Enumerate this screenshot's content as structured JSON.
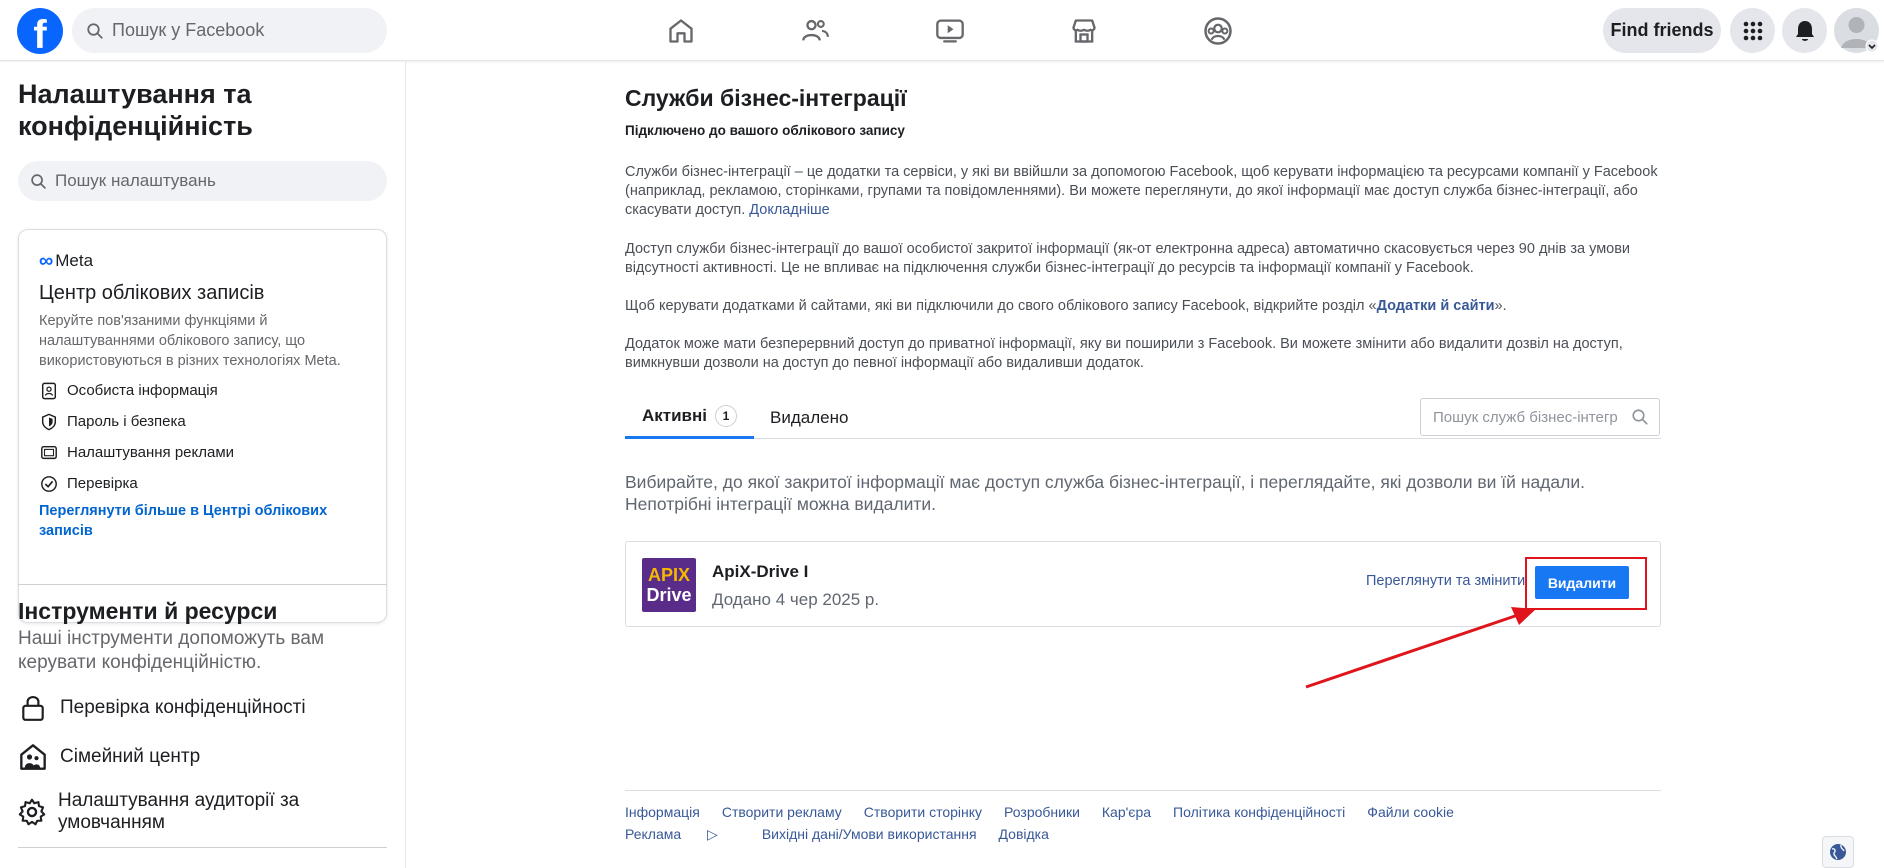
{
  "topbar": {
    "logo_letter": "f",
    "search_placeholder": "Пошук у Facebook",
    "nav_icons": [
      "home-icon",
      "friends-icon",
      "watch-icon",
      "marketplace-icon",
      "groups-icon"
    ],
    "find_friends_label": "Find friends",
    "right_icons": [
      "menu-grid-icon",
      "notifications-bell-icon",
      "account-avatar-icon"
    ]
  },
  "sidebar": {
    "title": "Налаштування та конфіденційність",
    "search_placeholder": "Пошук налаштувань",
    "meta_card": {
      "brand": "Meta",
      "title": "Центр облікових записів",
      "description": "Керуйте пов'язаними функціями й налаштуваннями облікового запису, що використовуються в різних технологіях Meta.",
      "items": [
        {
          "label": "Особиста інформація",
          "icon": "id-card-icon"
        },
        {
          "label": "Пароль і безпека",
          "icon": "shield-icon"
        },
        {
          "label": "Налаштування реклами",
          "icon": "monitor-icon"
        },
        {
          "label": "Перевірка",
          "icon": "verified-badge-icon"
        }
      ],
      "link": "Переглянути більше в Центрі облікових записів"
    },
    "tools": {
      "title": "Інструменти й ресурси",
      "description": "Наші інструменти допоможуть вам керувати конфіденційністю.",
      "items": [
        {
          "label": "Перевірка конфіденційності",
          "icon": "lock-icon"
        },
        {
          "label": "Сімейний центр",
          "icon": "family-home-icon"
        },
        {
          "label": "Налаштування аудиторії за умовчанням",
          "icon": "gear-icon"
        }
      ]
    }
  },
  "main": {
    "title": "Служби бізнес-інтеграції",
    "subtitle": "Підключено до вашого облікового запису",
    "para1_text": "Служби бізнес-інтеграції – це додатки та сервіси, у які ви ввійшли за допомогою Facebook, щоб керувати інформацією та ресурсами компанії у Facebook (наприклад, рекламою, сторінками, групами та повідомленнями). Ви можете переглянути, до якої інформації має доступ служба бізнес-інтеграції, або скасувати доступ. ",
    "para1_link": "Докладніше",
    "para2": "Доступ служби бізнес-інтеграції до вашої особистої закритої інформації (як-от електронна адреса) автоматично скасовується через 90 днів за умови відсутності активності. Це не впливає на підключення служби бізнес-інтеграції до ресурсів та інформації компанії у Facebook.",
    "para3_before": "Щоб керувати додатками й сайтами, які ви підключили до свого облікового запису Facebook, відкрийте розділ «",
    "para3_link": "Додатки й сайти",
    "para3_after": "».",
    "para4": "Додаток може мати безперервний доступ до приватної інформації, яку ви поширили з Facebook. Ви можете змінити або видалити дозвіл на доступ, вимкнувши дозволи на доступ до певної інформації або видаливши додаток.",
    "tabs": {
      "active_label": "Активні",
      "active_count": "1",
      "removed_label": "Видалено",
      "search_placeholder": "Пошук служб бізнес-інтегр"
    },
    "intro": "Вибирайте, до якої закритої інформації має доступ служба бізнес-інтеграції, і переглядайте, які дозволи ви їй надали. Непотрібні інтеграції можна видалити.",
    "app": {
      "logo_top": "APIX",
      "logo_bottom": "Drive",
      "name": "ApiX-Drive I",
      "added": "Додано 4 чер 2025 р.",
      "view_edit_label": "Переглянути та змінити",
      "remove_label": "Видалити"
    },
    "annotation_color": "#e0151b",
    "footer_links": [
      "Інформація",
      "Створити рекламу",
      "Створити сторінку",
      "Розробники",
      "Кар'єра",
      "Політика конфіденційності",
      "Файли cookie",
      "Реклама",
      "Вихідні дані/Умови використання",
      "Довідка"
    ]
  }
}
